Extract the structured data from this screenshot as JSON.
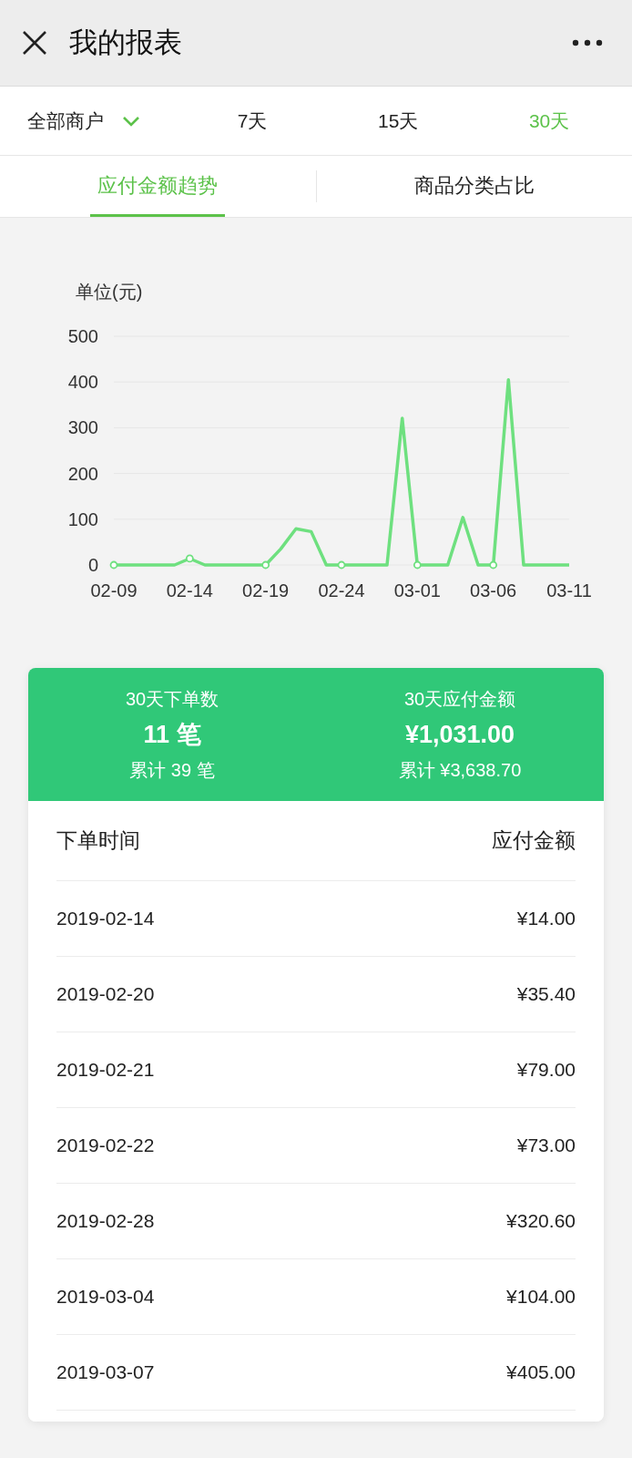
{
  "header": {
    "title": "我的报表"
  },
  "filters": {
    "merchant": "全部商户",
    "ranges": [
      {
        "label": "7天",
        "selected": false
      },
      {
        "label": "15天",
        "selected": false
      },
      {
        "label": "30天",
        "selected": true
      }
    ]
  },
  "tabs": [
    {
      "label": "应付金额趋势",
      "selected": true
    },
    {
      "label": "商品分类占比",
      "selected": false
    }
  ],
  "chart_data": {
    "type": "line",
    "ylabel": "单位(元)",
    "categories": [
      "02-09",
      null,
      null,
      null,
      null,
      "02-14",
      null,
      null,
      null,
      null,
      "02-19",
      null,
      null,
      null,
      null,
      "02-24",
      null,
      null,
      null,
      null,
      "03-01",
      null,
      null,
      null,
      null,
      "03-06",
      null,
      null,
      null,
      null,
      "03-11"
    ],
    "series": [
      {
        "color": "#6ee07f",
        "values": [
          0,
          0,
          0,
          0,
          0,
          14,
          0,
          0,
          0,
          0,
          0,
          35,
          79,
          73,
          0,
          0,
          0,
          0,
          0,
          321,
          0,
          0,
          0,
          104,
          0,
          0,
          405,
          0,
          0,
          0,
          0
        ]
      }
    ],
    "ylim": [
      0,
      500
    ],
    "grid": true,
    "yticks": [
      0,
      100,
      200,
      300,
      400,
      500
    ]
  },
  "summary": [
    {
      "label": "30天下单数",
      "value": "11 笔",
      "total": "累计 39 笔"
    },
    {
      "label": "30天应付金额",
      "value": "¥1,031.00",
      "total": "累计 ¥3,638.70"
    }
  ],
  "table": {
    "columns": [
      "下单时间",
      "应付金额"
    ],
    "rows": [
      [
        "2019-02-14",
        "¥14.00"
      ],
      [
        "2019-02-20",
        "¥35.40"
      ],
      [
        "2019-02-21",
        "¥79.00"
      ],
      [
        "2019-02-22",
        "¥73.00"
      ],
      [
        "2019-02-28",
        "¥320.60"
      ],
      [
        "2019-03-04",
        "¥104.00"
      ],
      [
        "2019-03-07",
        "¥405.00"
      ]
    ]
  }
}
